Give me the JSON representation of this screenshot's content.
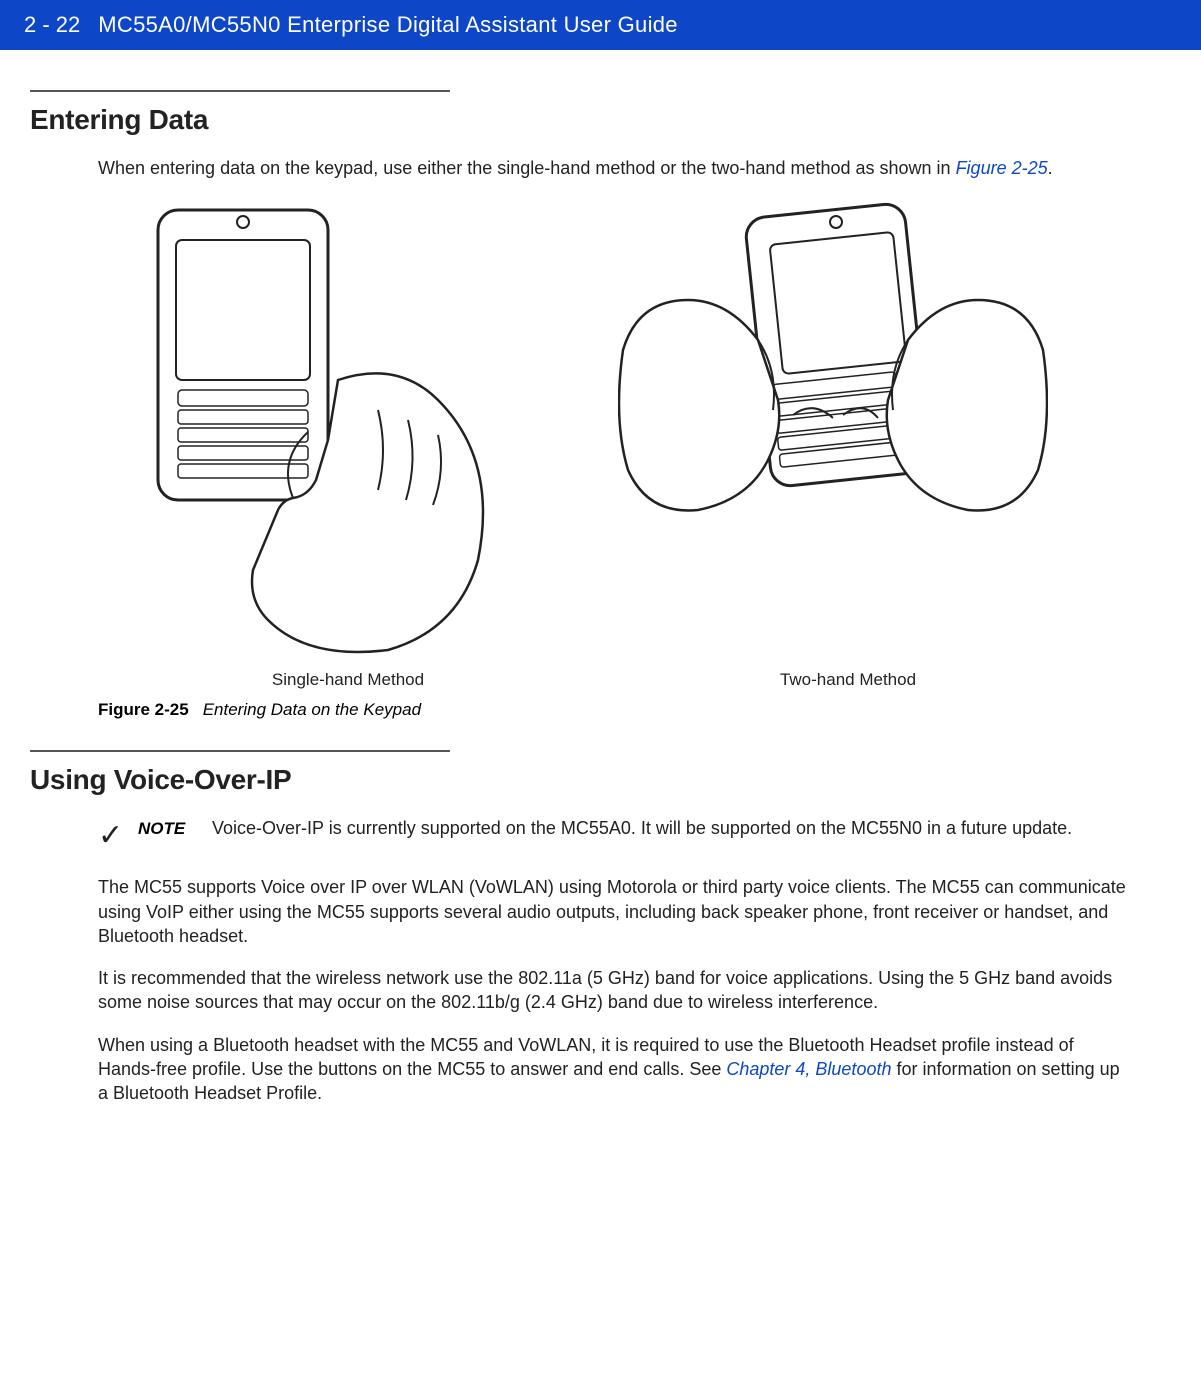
{
  "header": {
    "page_number": "2 - 22",
    "title": "MC55A0/MC55N0 Enterprise Digital Assistant User Guide"
  },
  "section1": {
    "heading": "Entering Data",
    "intro_pre": "When entering data on the keypad, use either the single-hand method or the two-hand method as shown in ",
    "intro_link": "Figure 2-25",
    "intro_post": ".",
    "caption_left": "Single-hand Method",
    "caption_right": "Two-hand Method",
    "figure_num": "Figure 2-25",
    "figure_title": "Entering Data on the Keypad"
  },
  "section2": {
    "heading": "Using Voice-Over-IP",
    "note_label": "NOTE",
    "note_text": "Voice-Over-IP is currently supported on the MC55A0. It will be supported on the MC55N0 in a future update.",
    "para1": "The MC55 supports Voice over IP over WLAN (VoWLAN) using Motorola or third party voice clients. The MC55 can communicate using VoIP either using the MC55 supports several audio outputs, including back speaker phone, front receiver or handset, and Bluetooth headset.",
    "para2": "It is recommended that the wireless network use the 802.11a (5 GHz) band for voice applications. Using the 5 GHz band avoids some noise sources that may occur on the 802.11b/g (2.4 GHz) band due to wireless interference.",
    "para3_pre": "When using a Bluetooth headset with the MC55 and VoWLAN, it is required to use the Bluetooth Headset profile instead of Hands-free profile. Use the buttons on the MC55 to answer and end calls. See ",
    "para3_link": "Chapter 4, Bluetooth",
    "para3_post": " for information on setting up a Bluetooth Headset Profile."
  }
}
